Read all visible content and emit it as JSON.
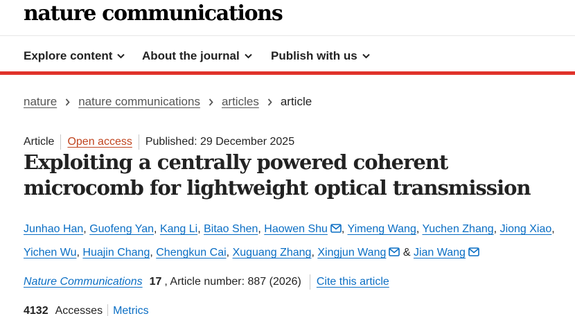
{
  "site": {
    "logo": "nature communications"
  },
  "nav": {
    "items": [
      {
        "label": "Explore content"
      },
      {
        "label": "About the journal"
      },
      {
        "label": "Publish with us"
      }
    ]
  },
  "breadcrumb": {
    "items": [
      "nature",
      "nature communications",
      "articles"
    ],
    "current": "article"
  },
  "article": {
    "type": "Article",
    "access": "Open access",
    "published": "Published: 29 December 2025",
    "title": "Exploiting a centrally powered coherent microcomb for lightweight optical transmission",
    "authors": [
      "Junhao Han",
      "Guofeng Yan",
      "Kang Li",
      "Bitao Shen",
      "Haowen Shu",
      "Yimeng Wang",
      "Yuchen Zhang",
      "Jiong Xiao",
      "Yichen Wu",
      "Huajin Chang",
      "Chengkun Cai",
      "Xuguang Zhang",
      "Xingjun Wang",
      "Jian Wang"
    ],
    "separator": ",",
    "ampersand": "&",
    "journal": "Nature Communications",
    "volume": "17",
    "article_number": ", Article number: 887 (2026)",
    "cite_label": "Cite this article",
    "accesses_count": "4132",
    "accesses_label": "Accesses",
    "metrics_label": "Metrics"
  },
  "colors": {
    "accent_red": "#e0322a",
    "link_blue": "#0a6ec4",
    "open_access_orange": "#c0441e"
  }
}
